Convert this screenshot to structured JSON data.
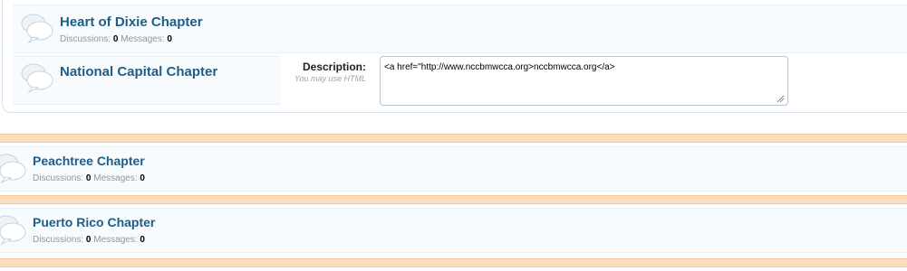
{
  "nodes": [
    {
      "title": "Heart of Dixie Chapter",
      "discussions_label": "Discussions:",
      "discussions": "0",
      "messages_label": "Messages:",
      "messages": "0"
    },
    {
      "title": "National Capital Chapter"
    },
    {
      "title": "Peachtree Chapter",
      "discussions_label": "Discussions:",
      "discussions": "0",
      "messages_label": "Messages:",
      "messages": "0"
    },
    {
      "title": "Puerto Rico Chapter",
      "discussions_label": "Discussions:",
      "discussions": "0",
      "messages_label": "Messages:",
      "messages": "0"
    }
  ],
  "editor": {
    "label": "Description:",
    "hint": "You may use HTML",
    "value": "<a href=\"http://www.nccbmwcca.org>nccbmwcca.org</a>"
  },
  "colors": {
    "title": "#1f5d86",
    "category_bar": "#fbdcbd",
    "row_bg": "#f8fbfd"
  },
  "icons": [
    "forum-bubble-icon",
    "resize-grip-icon"
  ]
}
